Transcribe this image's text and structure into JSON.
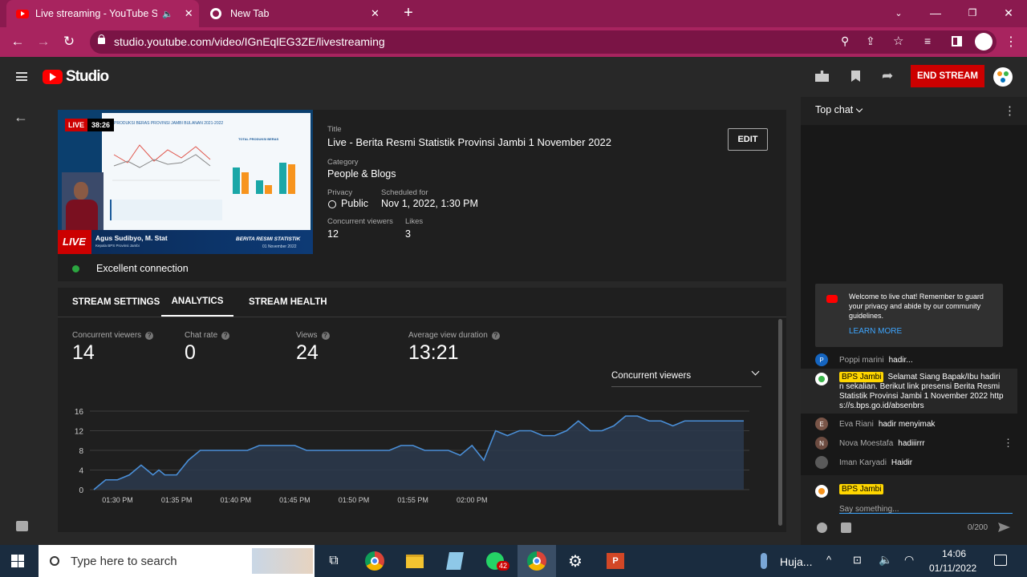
{
  "browser": {
    "tabs": [
      {
        "title": "Live streaming - YouTube Stu",
        "active": true
      },
      {
        "title": "New Tab",
        "active": false
      }
    ],
    "url": "studio.youtube.com/video/IGnEqlEG3ZE/livestreaming"
  },
  "header": {
    "logo_text": "Studio",
    "end_stream": "END STREAM"
  },
  "preview": {
    "live_badge": "LIVE",
    "elapsed": "38:26",
    "thumb_title": "PRODUKSI BERAS PROVINSI JAMBI BULANAN 2021-2022",
    "thumb_live": "LIVE",
    "presenter": "Agus Sudibyo, M. Stat",
    "presenter_role": "Kepala BPS Provinsi Jambi",
    "program": "BERITA RESMI STATISTIK",
    "program_date": "01 November 2022",
    "thumb_chart_title": "TOTAL PRODUKSI BERAS",
    "connection": "Excellent connection"
  },
  "details": {
    "title_label": "Title",
    "title": "Live - Berita Resmi Statistik Provinsi Jambi 1 November 2022",
    "edit": "EDIT",
    "category_label": "Category",
    "category": "People & Blogs",
    "privacy_label": "Privacy",
    "privacy": "Public",
    "scheduled_label": "Scheduled for",
    "scheduled": "Nov 1, 2022, 1:30 PM",
    "viewers_label": "Concurrent viewers",
    "viewers": "12",
    "likes_label": "Likes",
    "likes": "3"
  },
  "tabs": [
    "STREAM SETTINGS",
    "ANALYTICS",
    "STREAM HEALTH"
  ],
  "metrics": [
    {
      "label": "Concurrent viewers",
      "value": "14"
    },
    {
      "label": "Chat rate",
      "value": "0"
    },
    {
      "label": "Views",
      "value": "24"
    },
    {
      "label": "Average view duration",
      "value": "13:21"
    }
  ],
  "chart_select": "Concurrent viewers",
  "chart_data": {
    "type": "area",
    "x_ticks": [
      "01:30 PM",
      "01:35 PM",
      "01:40 PM",
      "01:45 PM",
      "01:50 PM",
      "01:55 PM",
      "02:00 PM"
    ],
    "y_ticks": [
      "16",
      "12",
      "8",
      "4",
      "0"
    ],
    "ylim": [
      0,
      16
    ],
    "x_minutes_after_1_28pm": [
      0,
      1,
      2,
      3,
      4,
      5,
      5.5,
      6,
      6.5,
      7,
      8,
      9,
      10,
      11,
      12,
      13,
      14,
      15,
      16,
      17,
      18,
      19,
      20,
      21,
      22,
      23,
      24,
      25,
      26,
      27,
      28,
      29,
      30,
      31,
      32,
      33,
      34,
      35,
      36,
      37,
      38,
      39,
      40,
      41,
      42,
      43,
      44,
      45,
      46,
      47,
      48,
      49,
      50,
      51,
      52,
      53,
      54,
      55
    ],
    "series": [
      {
        "values": [
          0,
          2,
          2,
          3,
          5,
          3,
          4,
          3,
          3,
          3,
          6,
          8,
          8,
          8,
          8,
          8,
          9,
          9,
          9,
          9,
          8,
          8,
          8,
          8,
          8,
          8,
          8,
          8,
          9,
          9,
          8,
          8,
          8,
          7,
          9,
          6,
          12,
          11,
          12,
          12,
          11,
          11,
          12,
          14,
          12,
          12,
          13,
          15,
          15,
          14,
          14,
          13,
          14,
          14,
          14,
          14,
          14,
          14
        ]
      }
    ]
  },
  "chat": {
    "header": "Top chat",
    "welcome": "Welcome to live chat! Remember to guard your privacy and abide by our community guidelines.",
    "learn_more": "LEARN MORE",
    "messages": [
      {
        "name": "Poppi marini",
        "text": "hadir..."
      },
      {
        "name": "BPS Jambi",
        "text": "Selamat Siang Bapak/Ibu hadirin sekalian. Berikut link presensi Berita Resmi Statistik Provinsi Jambi 1 November 2022 https://s.bps.go.id/absenbrs"
      },
      {
        "name": "Eva Riani",
        "text": "hadir menyimak"
      },
      {
        "name": "Nova Moestafa",
        "text": "hadiiirrr"
      },
      {
        "name": "Iman Karyadi",
        "text": "Haidir"
      }
    ],
    "initials": [
      "P",
      "E",
      "N"
    ],
    "input_name": "BPS Jambi",
    "input_placeholder": "Say something...",
    "counter": "0/200"
  },
  "taskbar": {
    "search": "Type here to search",
    "chrome_badge": "42",
    "weather": "Huja...",
    "time": "14:06",
    "date": "01/11/2022"
  },
  "colors": {
    "live_red": "#cc0000",
    "accent_blue": "#3ea6ff",
    "chart_line": "#4a8fd8",
    "badge_yellow": "#ffd600"
  }
}
